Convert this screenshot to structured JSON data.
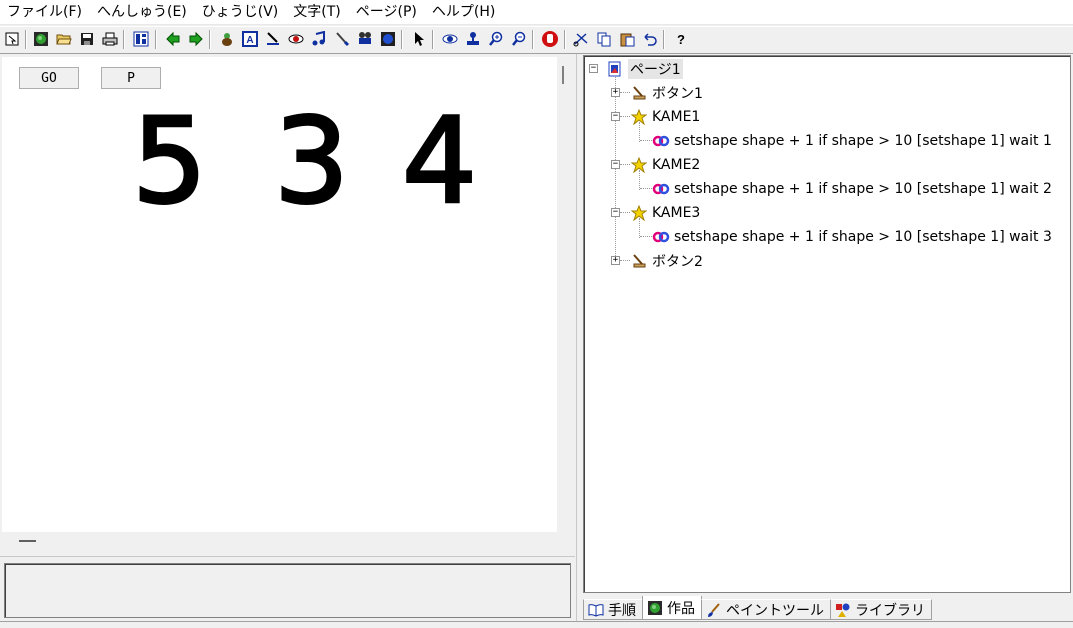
{
  "menu": [
    "ファイル(F)",
    "へんしゅう(E)",
    "ひょうじ(V)",
    "文字(T)",
    "ページ(P)",
    "ヘルプ(H)"
  ],
  "toolbar": {
    "icons": [
      "pointer-small-icon",
      "globe-icon",
      "open-folder-icon",
      "save-icon",
      "print-icon",
      "layout-icon",
      "back-arrow-icon",
      "forward-arrow-icon",
      "turtle-icon",
      "text-box-icon",
      "pen-icon",
      "eye-shape-icon",
      "music-icon",
      "brush-icon",
      "video-icon",
      "record-icon",
      "arrow-cursor-icon",
      "eye-icon",
      "stamp-icon",
      "zoom-in-icon",
      "zoom-out-icon",
      "stop-hand-icon",
      "cut-icon",
      "copy-icon",
      "paste-icon",
      "undo-icon",
      "help-icon"
    ],
    "help_label": "?"
  },
  "stage": {
    "buttons": [
      {
        "label": "GO"
      },
      {
        "label": "P"
      }
    ],
    "digits": [
      "5",
      "3",
      "4"
    ]
  },
  "tree": {
    "root": "ページ1",
    "items": [
      {
        "label": "ボタン1",
        "type": "button",
        "expander": "+"
      },
      {
        "label": "KAME1",
        "type": "turtle",
        "expander": "−"
      },
      {
        "label": "setshape shape + 1 if shape > 10 [setshape 1] wait 1",
        "type": "script"
      },
      {
        "label": "KAME2",
        "type": "turtle",
        "expander": "−"
      },
      {
        "label": "setshape shape + 1 if shape > 10 [setshape 1] wait 2",
        "type": "script"
      },
      {
        "label": "KAME3",
        "type": "turtle",
        "expander": "−"
      },
      {
        "label": "setshape shape + 1 if shape > 10 [setshape 1] wait 3",
        "type": "script"
      },
      {
        "label": "ボタン2",
        "type": "button",
        "expander": "+"
      }
    ],
    "root_expander": "−"
  },
  "tabs": [
    {
      "label": "手順",
      "icon": "book-icon"
    },
    {
      "label": "作品",
      "icon": "globe-icon",
      "active": true
    },
    {
      "label": "ペイントツール",
      "icon": "paintbrush-icon"
    },
    {
      "label": "ライブラリ",
      "icon": "library-icon"
    }
  ],
  "colors": {
    "turtle": "#f5d300",
    "script_icon_left": "#e0007a",
    "script_icon_right": "#3050e0",
    "page_icon": "#2040c0"
  }
}
